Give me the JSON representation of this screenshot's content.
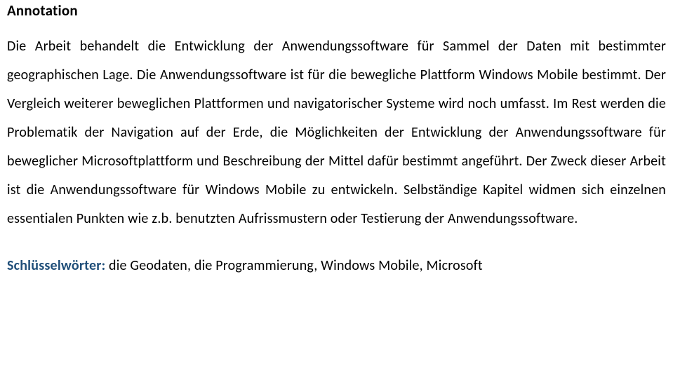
{
  "heading": "Annotation",
  "paragraph": "Die Arbeit behandelt die Entwicklung der Anwendungssoftware für Sammel der Daten mit bestimmter geographischen Lage. Die Anwendungssoftware ist für die bewegliche Plattform Windows Mobile bestimmt. Der Vergleich weiterer beweglichen Plattformen und navigatorischer Systeme wird noch umfasst. Im Rest werden die Problematik der Navigation auf der Erde, die Möglichkeiten der Entwicklung der Anwendungssoftware für beweglicher Microsoftplattform und Beschreibung der Mittel dafür bestimmt angeführt. Der Zweck dieser Arbeit ist die Anwendungssoftware für Windows Mobile zu entwickeln. Selbständige Kapitel widmen sich einzelnen essentialen Punkten wie z.b. benutzten Aufrissmustern oder Testierung der Anwendungssoftware.",
  "keywords_label": "Schlüsselwörter:",
  "keywords_text": " die Geodaten, die Programmierung, Windows Mobile, Microsoft"
}
